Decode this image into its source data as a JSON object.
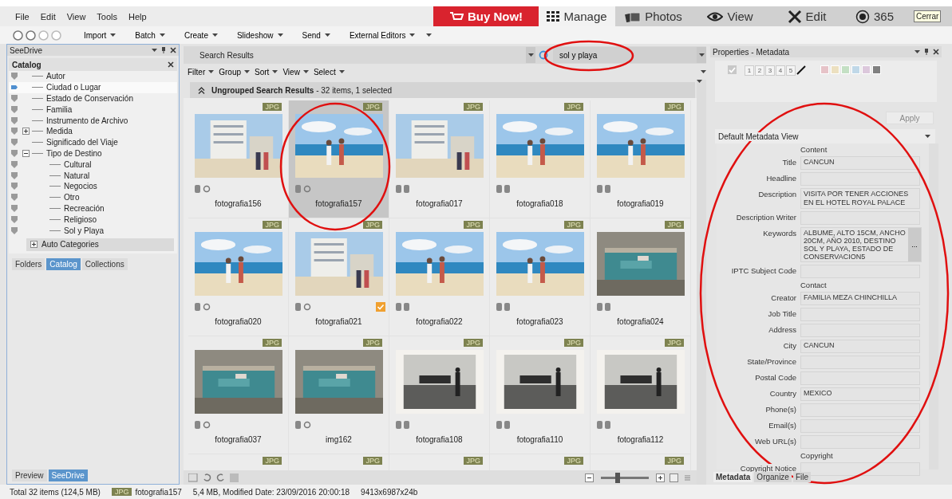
{
  "menu": [
    "File",
    "Edit",
    "View",
    "Tools",
    "Help"
  ],
  "modes": [
    {
      "label": "Buy Now!",
      "kind": "buy",
      "selected": false
    },
    {
      "label": "Manage",
      "kind": "manage",
      "selected": true
    },
    {
      "label": "Photos",
      "kind": "photos",
      "selected": false
    },
    {
      "label": "View",
      "kind": "view",
      "selected": false
    },
    {
      "label": "Edit",
      "kind": "edit",
      "selected": false
    },
    {
      "label": "365",
      "kind": "cloud",
      "selected": false
    }
  ],
  "tooltip": "Cerrar",
  "toolbar": [
    "Import",
    "Batch",
    "Create",
    "Slideshow",
    "Send",
    "External Editors"
  ],
  "left_panel": {
    "title": "SeeDrive",
    "catalog_title": "Catalog",
    "items": [
      {
        "label": "Autor",
        "selected": false
      },
      {
        "label": "Ciudad o Lugar",
        "selected": true
      },
      {
        "label": "Estado de Conservación",
        "selected": false
      },
      {
        "label": "Familia",
        "selected": false
      },
      {
        "label": "Instrumento de Archivo",
        "selected": false
      },
      {
        "label": "Medida",
        "selected": false,
        "expanded": false
      },
      {
        "label": "Significado del Viaje",
        "selected": false
      },
      {
        "label": "Tipo de Destino",
        "selected": false,
        "expanded": true,
        "children": [
          {
            "label": "Cultural",
            "selected": false
          },
          {
            "label": "Natural",
            "selected": false
          },
          {
            "label": "Negocios",
            "selected": false
          },
          {
            "label": "Otro",
            "selected": false
          },
          {
            "label": "Recreación",
            "selected": false
          },
          {
            "label": "Religioso",
            "selected": false
          },
          {
            "label": "Sol y Playa",
            "selected": false
          }
        ]
      }
    ],
    "auto_categories": "Auto Categories",
    "tabs": [
      {
        "label": "Folders",
        "selected": false
      },
      {
        "label": "Catalog",
        "selected": true
      },
      {
        "label": "Collections",
        "selected": false
      }
    ],
    "bottom_tabs": [
      {
        "label": "Preview",
        "selected": false
      },
      {
        "label": "SeeDrive",
        "selected": true
      }
    ]
  },
  "center": {
    "title": "Search Results",
    "search": {
      "value": "sol y playa"
    },
    "filters": [
      "Filter",
      "Group",
      "Sort",
      "View",
      "Select"
    ],
    "group": {
      "title": "Ungrouped Search Results",
      "summary": " - 32 items, 1 selected"
    },
    "items": [
      {
        "name": "fotografia156",
        "badge": "JPG",
        "selected": false,
        "tagged": false
      },
      {
        "name": "fotografia157",
        "badge": "JPG",
        "selected": true,
        "tagged": false
      },
      {
        "name": "fotografia017",
        "badge": "JPG",
        "selected": false,
        "tagged": false
      },
      {
        "name": "fotografia018",
        "badge": "JPG",
        "selected": false,
        "tagged": false
      },
      {
        "name": "fotografia019",
        "badge": "JPG",
        "selected": false,
        "tagged": false
      },
      {
        "name": "fotografia020",
        "badge": "JPG",
        "selected": false,
        "tagged": false
      },
      {
        "name": "fotografia021",
        "badge": "JPG",
        "selected": false,
        "tagged": true
      },
      {
        "name": "fotografia022",
        "badge": "JPG",
        "selected": false,
        "tagged": false
      },
      {
        "name": "fotografia023",
        "badge": "JPG",
        "selected": false,
        "tagged": false
      },
      {
        "name": "fotografia024",
        "badge": "JPG",
        "selected": false,
        "tagged": false
      },
      {
        "name": "fotografia037",
        "badge": "JPG",
        "selected": false,
        "tagged": false
      },
      {
        "name": "img162",
        "badge": "JPG",
        "selected": false,
        "tagged": false
      },
      {
        "name": "fotografia108",
        "badge": "JPG",
        "selected": false,
        "tagged": false
      },
      {
        "name": "fotografia110",
        "badge": "JPG",
        "selected": false,
        "tagged": false
      },
      {
        "name": "fotografia112",
        "badge": "JPG",
        "selected": false,
        "tagged": false
      }
    ],
    "next_row_badges": [
      "JPG",
      "JPG",
      "JPG",
      "JPG",
      "JPG"
    ],
    "zoom": {
      "level": 0.35
    }
  },
  "right_panel": {
    "title": "Properties - Metadata",
    "checked": true,
    "ratings": [
      "1",
      "2",
      "3",
      "4",
      "5"
    ],
    "labels": [
      {
        "color": "#e6c3c8"
      },
      {
        "color": "#ece0c0"
      },
      {
        "color": "#c4e0c4"
      },
      {
        "color": "#c0d8e8"
      },
      {
        "color": "#dcc8dc"
      },
      {
        "color": "#808080"
      }
    ],
    "apply": "Apply",
    "view": "Default Metadata View",
    "fields": [
      {
        "kind": "section",
        "label": "Content"
      },
      {
        "kind": "field",
        "label": "Title",
        "value": "CANCUN"
      },
      {
        "kind": "field",
        "label": "Headline"
      },
      {
        "kind": "field",
        "label": "Description",
        "value": "VISITA POR TENER ACCIONES EN EL HOTEL ROYAL PALACE"
      },
      {
        "kind": "field",
        "label": "Description Writer"
      },
      {
        "kind": "list",
        "label": "Keywords",
        "value": "ALBUME, ALTO 15CM, ANCHO 20CM, AÑO 2010, DESTINO SOL Y PLAYA, ESTADO DE CONSERVACION5",
        "button": "..."
      },
      {
        "kind": "field",
        "label": "IPTC Subject Code"
      },
      {
        "kind": "section",
        "label": "Contact"
      },
      {
        "kind": "field",
        "label": "Creator",
        "value": "FAMILIA MEZA CHINCHILLA"
      },
      {
        "kind": "field",
        "label": "Job Title"
      },
      {
        "kind": "field",
        "label": "Address"
      },
      {
        "kind": "field",
        "label": "City",
        "value": "CANCUN"
      },
      {
        "kind": "field",
        "label": "State/Province"
      },
      {
        "kind": "field",
        "label": "Postal Code"
      },
      {
        "kind": "field",
        "label": "Country",
        "value": "MEXICO"
      },
      {
        "kind": "field",
        "label": "Phone(s)"
      },
      {
        "kind": "field",
        "label": "Email(s)"
      },
      {
        "kind": "field",
        "label": "Web URL(s)"
      },
      {
        "kind": "section",
        "label": "Copyright"
      },
      {
        "kind": "field",
        "label": "Copyright Notice"
      }
    ],
    "tabs": [
      {
        "label": "Metadata",
        "selected": true
      },
      {
        "label": "Organize",
        "selected": false
      },
      {
        "label": "File",
        "selected": false
      }
    ]
  },
  "status": {
    "total": "Total 32 items  (124,5 MB)",
    "badge": "JPG",
    "file": "fotografia157",
    "info": "5,4 MB, Modified Date: 23/09/2016 20:00:18",
    "dims": "9413x6987x24b"
  }
}
